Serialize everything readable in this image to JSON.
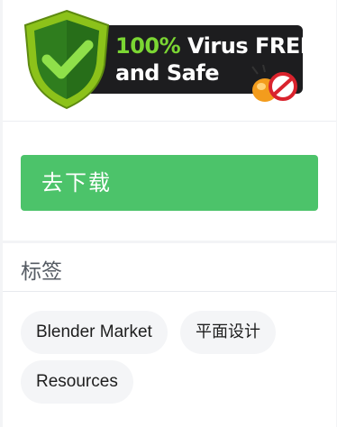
{
  "badge": {
    "line1_pct": "100%",
    "line1_rest": " Virus FREE",
    "line2": "and Safe",
    "icons": [
      "shield-check-icon",
      "bug-forbidden-icon"
    ],
    "colors": {
      "bar": "#1d1d1f",
      "accent": "#7bd633",
      "shield": "#8cc21a"
    }
  },
  "download": {
    "label": "去下载",
    "color": "#4cc36a"
  },
  "tags": {
    "title": "标签",
    "items": [
      "Blender Market",
      "平面设计",
      "Resources"
    ]
  }
}
